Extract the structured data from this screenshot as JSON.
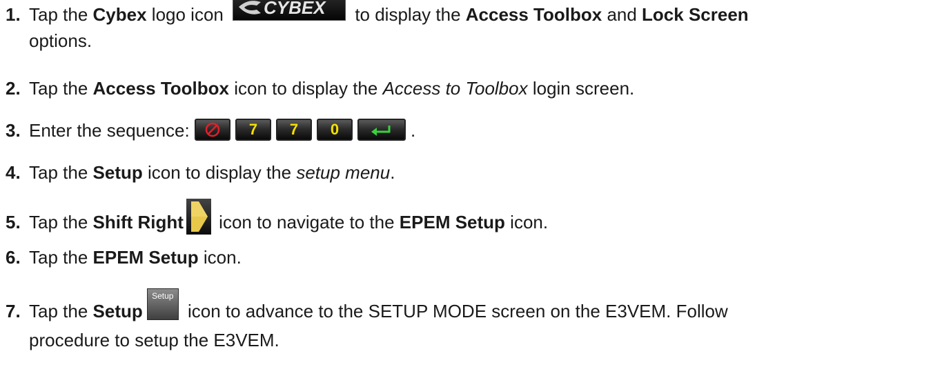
{
  "steps": [
    {
      "num": "1.",
      "t1": "Tap the ",
      "b1": "Cybex",
      "t2": " logo icon ",
      "t3": " to display the ",
      "b2": "Access Toolbox",
      "t4": " and ",
      "b3": "Lock Screen",
      "t5": "options.",
      "icon": "cybex-logo-icon",
      "logo_text": "CYBEX"
    },
    {
      "num": "2.",
      "t1": "Tap the ",
      "b1": "Access Toolbox",
      "t2": " icon to display the ",
      "i1": "Access to Toolbox",
      "t3": " login screen."
    },
    {
      "num": "3.",
      "t1": "Enter the sequence: ",
      "keys": [
        "cancel-key-icon",
        "7",
        "7",
        "0",
        "enter-key-icon"
      ],
      "t2": "."
    },
    {
      "num": "4.",
      "t1": "Tap the ",
      "b1": "Setup",
      "t2": " icon to display the ",
      "i1": "setup menu",
      "t3": "."
    },
    {
      "num": "5.",
      "t1": "Tap the ",
      "b1": "Shift Right",
      "t2": " icon to navigate to the ",
      "b2": "EPEM Setup",
      "t3": " icon.",
      "icon": "shift-right-icon"
    },
    {
      "num": "6.",
      "t1": "Tap the ",
      "b1": "EPEM Setup",
      "t2": " icon."
    },
    {
      "num": "7.",
      "t1": "Tap the ",
      "b1": "Setup",
      "t2": " icon to advance to the SETUP MODE screen on the E3VEM. Follow",
      "t3": "procedure to setup the E3VEM.",
      "icon": "setup-button-icon",
      "icon_label": "Setup"
    }
  ],
  "colors": {
    "text": "#1a1a1a",
    "key_digit": "#f6e000",
    "cancel_red": "#e0202a",
    "enter_green": "#39d23c",
    "shift_arrow": "#e8c84a"
  }
}
